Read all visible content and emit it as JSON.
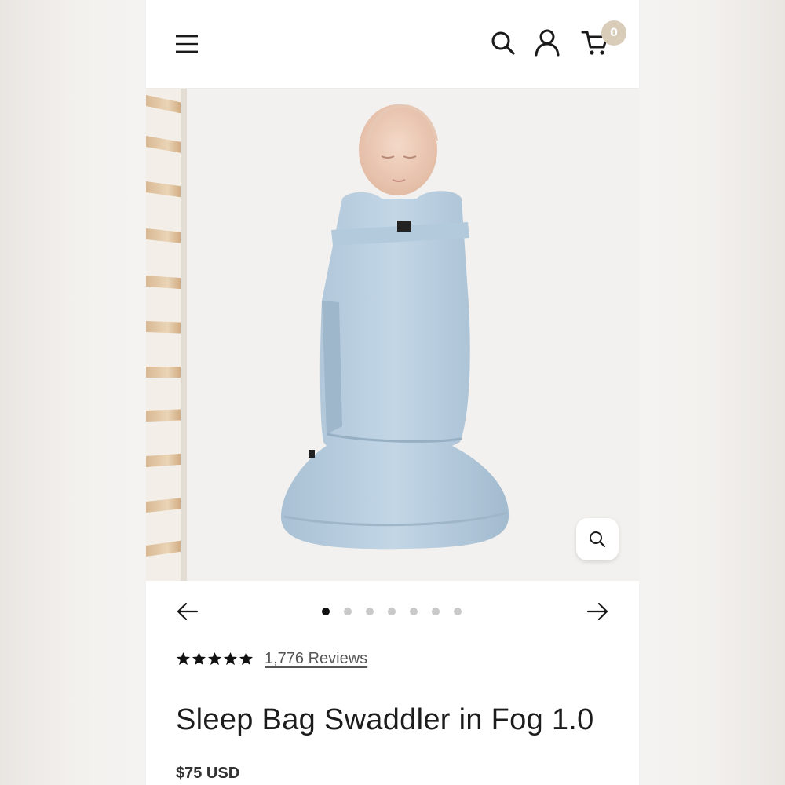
{
  "header": {
    "menu_icon": "menu-icon",
    "search_icon": "search-icon",
    "account_icon": "account-icon",
    "cart_icon": "cart-icon",
    "cart_count": "0"
  },
  "carousel": {
    "image_count": 7,
    "active_index": 0,
    "prev_icon": "arrow-left-icon",
    "next_icon": "arrow-right-icon",
    "zoom_icon": "magnifier-icon"
  },
  "product": {
    "rating": 5,
    "reviews_label": "1,776 Reviews",
    "title": "Sleep Bag Swaddler in Fog 1.0",
    "price": "$75 USD"
  },
  "colors": {
    "badge": "#d9cdb9",
    "swaddle": "#b9cfe0",
    "active_dot": "#111111",
    "inactive_dot": "#c9c9c9"
  }
}
